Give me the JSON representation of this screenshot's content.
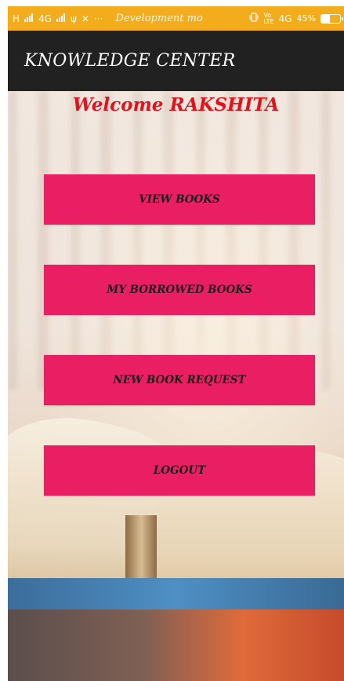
{
  "status_bar": {
    "left_items": [
      "H",
      "4G",
      "ψ",
      "✕",
      "···"
    ],
    "notification": "Development mo",
    "network_label": "4G",
    "battery_text": "45%",
    "battery_level": 0.45,
    "color": "#f3ac1c"
  },
  "app_bar": {
    "title": "KNOWLEDGE CENTER",
    "color": "#212121"
  },
  "welcome": {
    "text": "Welcome RAKSHITA",
    "color": "#e3121d"
  },
  "menu": {
    "button_color": "#e91e63",
    "buttons": [
      {
        "label": "VIEW BOOKS"
      },
      {
        "label": "MY BORROWED BOOKS"
      },
      {
        "label": "NEW BOOK REQUEST"
      },
      {
        "label": "LOGOUT"
      }
    ]
  }
}
